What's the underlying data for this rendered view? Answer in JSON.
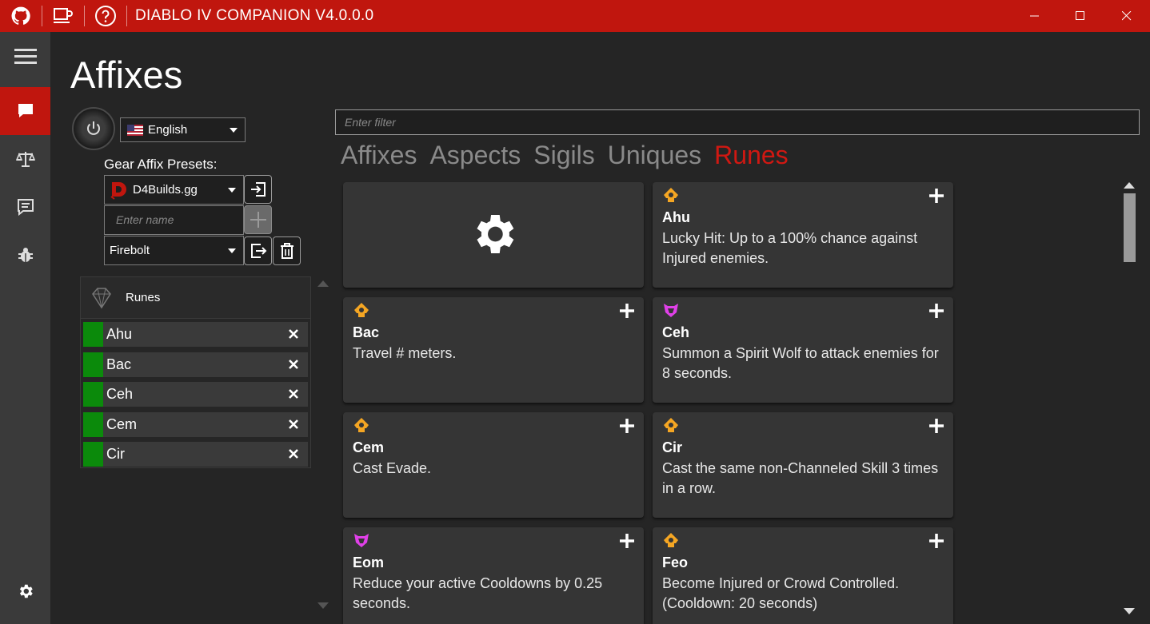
{
  "window": {
    "title": "DIABLO IV COMPANION V4.0.0.0",
    "accent": "#c0160e",
    "icons": [
      "github-icon",
      "coffee-icon",
      "help-icon"
    ],
    "controls": [
      "minimize-icon",
      "maximize-icon",
      "close-icon"
    ]
  },
  "sidebar": {
    "items": [
      {
        "icon": "menu-icon",
        "active": false
      },
      {
        "icon": "chat-icon",
        "active": true
      },
      {
        "icon": "scales-icon",
        "active": false
      },
      {
        "icon": "message-icon",
        "active": false
      },
      {
        "icon": "bug-icon",
        "active": false
      },
      {
        "icon": "gear-icon",
        "active": false
      }
    ]
  },
  "page": {
    "title": "Affixes",
    "language": "English",
    "presets_label": "Gear Affix Presets:",
    "preset_source": "D4Builds.gg",
    "name_placeholder": "Enter name",
    "selected_preset": "Firebolt",
    "filter_placeholder": "Enter filter"
  },
  "runes_panel": {
    "title": "Runes",
    "items": [
      "Ahu",
      "Bac",
      "Ceh",
      "Cem",
      "Cir"
    ],
    "item_color": "#0b8a0b"
  },
  "tabs": [
    {
      "label": "Affixes",
      "active": false
    },
    {
      "label": "Aspects",
      "active": false
    },
    {
      "label": "Sigils",
      "active": false
    },
    {
      "label": "Uniques",
      "active": false
    },
    {
      "label": "Runes",
      "active": true
    }
  ],
  "cards": [
    {
      "name": "Ahu",
      "desc": "Lucky Hit: Up to a 100% chance against Injured enemies.",
      "kind": "condition"
    },
    {
      "name": "Bac",
      "desc": "Travel # meters.",
      "kind": "condition"
    },
    {
      "name": "Ceh",
      "desc": "Summon a Spirit Wolf to attack enemies for 8 seconds.",
      "kind": "effect"
    },
    {
      "name": "Cem",
      "desc": "Cast Evade.",
      "kind": "condition"
    },
    {
      "name": "Cir",
      "desc": "Cast the same non-Channeled Skill 3 times in a row.",
      "kind": "condition"
    },
    {
      "name": "Eom",
      "desc": "Reduce your active Cooldowns by 0.25 seconds.",
      "kind": "effect"
    },
    {
      "name": "Feo",
      "desc": "Become Injured or Crowd Controlled. (Cooldown: 20 seconds)",
      "kind": "condition"
    }
  ],
  "colors": {
    "condition": "#f5a623",
    "effect": "#e040e8"
  }
}
